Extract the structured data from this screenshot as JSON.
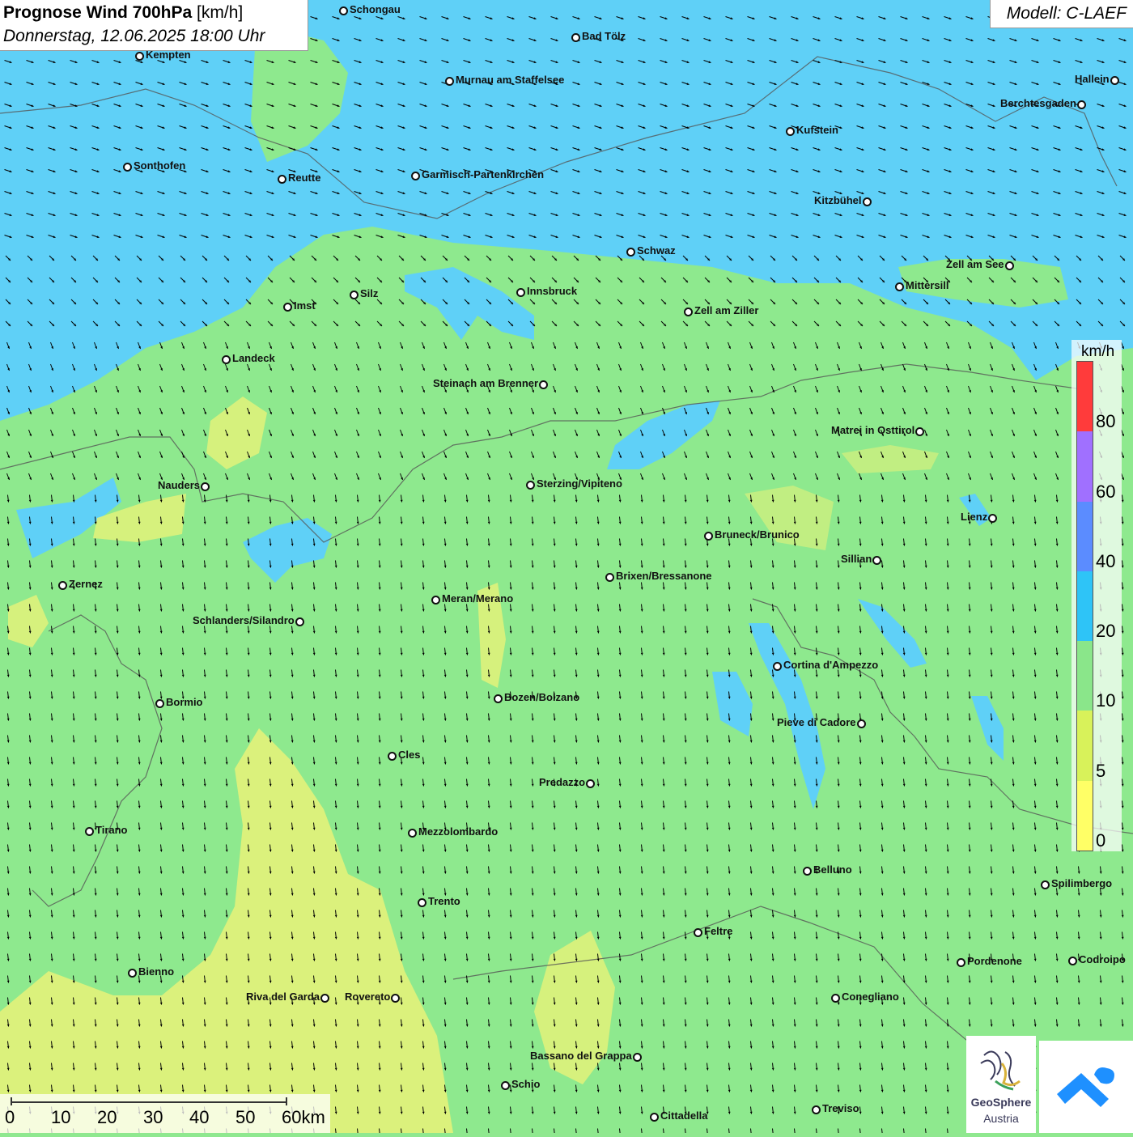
{
  "header": {
    "title_bold": "Prognose Wind 700hPa",
    "title_unit": "[km/h]",
    "datetime": "Donnerstag, 12.06.2025 18:00 Uhr",
    "model": "Modell: C-LAEF"
  },
  "legend": {
    "unit": "km/h",
    "labels": [
      "80",
      "60",
      "40",
      "20",
      "10",
      "5",
      "0"
    ],
    "colors": [
      "#ff3b3b",
      "#a070ff",
      "#5b8cff",
      "#2ec4f7",
      "#8ae68a",
      "#d8f25a",
      "#ffff66"
    ]
  },
  "scale_bar": {
    "labels": [
      "0",
      "10",
      "20",
      "30",
      "40",
      "50",
      "60km"
    ]
  },
  "logos": {
    "geosphere_line1": "GeoSphere",
    "geosphere_line2": "Austria"
  },
  "colors": {
    "zone_blue": "#5fd0f7",
    "zone_green": "#8ee98e",
    "zone_yellow": "#e3f27a"
  },
  "cities": [
    {
      "name": "Schongau",
      "label_side": "right"
    },
    {
      "name": "Bad Tölz",
      "label_side": "right"
    },
    {
      "name": "Kempten",
      "label_side": "right"
    },
    {
      "name": "Murnau am Staffelsee",
      "label_side": "right"
    },
    {
      "name": "Hallein",
      "label_side": "left"
    },
    {
      "name": "Berchtesgaden",
      "label_side": "left"
    },
    {
      "name": "Kufstein",
      "label_side": "right"
    },
    {
      "name": "Sonthofen",
      "label_side": "right"
    },
    {
      "name": "Reutte",
      "label_side": "right"
    },
    {
      "name": "Garmisch-Partenkirchen",
      "label_side": "right"
    },
    {
      "name": "Kitzbühel",
      "label_side": "left"
    },
    {
      "name": "Schwaz",
      "label_side": "right"
    },
    {
      "name": "Zell am See",
      "label_side": "left"
    },
    {
      "name": "Mittersill",
      "label_side": "right"
    },
    {
      "name": "Innsbruck",
      "label_side": "right"
    },
    {
      "name": "Silz",
      "label_side": "right"
    },
    {
      "name": "Imst",
      "label_side": "right"
    },
    {
      "name": "Zell am Ziller",
      "label_side": "right"
    },
    {
      "name": "Landeck",
      "label_side": "right"
    },
    {
      "name": "Steinach am Brenner",
      "label_side": "left"
    },
    {
      "name": "Matrei in Osttirol",
      "label_side": "left"
    },
    {
      "name": "Nauders",
      "label_side": "left"
    },
    {
      "name": "Sterzing/Vipiteno",
      "label_side": "right"
    },
    {
      "name": "Lienz",
      "label_side": "left"
    },
    {
      "name": "Bruneck/Brunico",
      "label_side": "right"
    },
    {
      "name": "Sillian",
      "label_side": "left"
    },
    {
      "name": "Zernez",
      "label_side": "right"
    },
    {
      "name": "Brixen/Bressanone",
      "label_side": "right"
    },
    {
      "name": "Meran/Merano",
      "label_side": "right"
    },
    {
      "name": "Schlanders/Silandro",
      "label_side": "left"
    },
    {
      "name": "Cortina d'Ampezzo",
      "label_side": "right"
    },
    {
      "name": "Bozen/Bolzano",
      "label_side": "right"
    },
    {
      "name": "Bormio",
      "label_side": "right"
    },
    {
      "name": "Pieve di Cadore",
      "label_side": "left"
    },
    {
      "name": "Cles",
      "label_side": "right"
    },
    {
      "name": "Predazzo",
      "label_side": "left"
    },
    {
      "name": "Tirano",
      "label_side": "right"
    },
    {
      "name": "Mezzolombardo",
      "label_side": "right"
    },
    {
      "name": "Belluno",
      "label_side": "right"
    },
    {
      "name": "Spilimbergo",
      "label_side": "right"
    },
    {
      "name": "Trento",
      "label_side": "right"
    },
    {
      "name": "Feltre",
      "label_side": "right"
    },
    {
      "name": "Pordenone",
      "label_side": "right"
    },
    {
      "name": "Codroipo",
      "label_side": "right"
    },
    {
      "name": "Bienno",
      "label_side": "right"
    },
    {
      "name": "Riva del Garda",
      "label_side": "left"
    },
    {
      "name": "Rovereto",
      "label_side": "left"
    },
    {
      "name": "Conegliano",
      "label_side": "right"
    },
    {
      "name": "Bassano del Grappa",
      "label_side": "left"
    },
    {
      "name": "Schio",
      "label_side": "right"
    },
    {
      "name": "Treviso",
      "label_side": "right"
    },
    {
      "name": "Cittadella",
      "label_side": "right"
    }
  ]
}
